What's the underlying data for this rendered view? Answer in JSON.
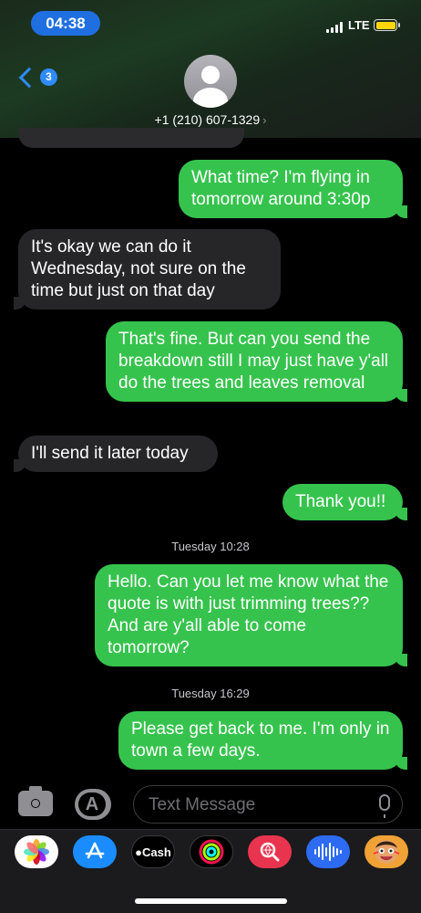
{
  "status_bar": {
    "time": "04:38",
    "network": "LTE"
  },
  "header": {
    "back_badge": "3",
    "contact": "+1 (210) 607-1329",
    "contact_chevron": "›"
  },
  "messages": [
    {
      "direction": "out",
      "text": "What time? I'm flying in tomorrow around 3:30p"
    },
    {
      "direction": "in",
      "text": "It's okay we can do it Wednesday,  not sure on the time but just on that day"
    },
    {
      "direction": "out",
      "text": "That's fine. But can you send the breakdown still I may just have y'all do the trees and leaves removal"
    },
    {
      "direction": "in",
      "text": "I'll send it later today"
    },
    {
      "direction": "out",
      "text": "Thank you!!"
    },
    {
      "direction": "out",
      "text": "Hello. Can you let me know what the quote is with just trimming trees?? And are y'all able to come tomorrow?"
    },
    {
      "direction": "out",
      "text": "Please get back to me. I'm only in town a few days."
    }
  ],
  "timestamps": [
    "Tuesday 10:28",
    "Tuesday 16:29"
  ],
  "input": {
    "placeholder": "Text Message"
  },
  "apps": [
    {
      "name": "photos-app-icon"
    },
    {
      "name": "app-store-icon"
    },
    {
      "name": "apple-cash-icon",
      "label": "Cash"
    },
    {
      "name": "activity-icon"
    },
    {
      "name": "web-search-icon"
    },
    {
      "name": "audio-message-icon"
    },
    {
      "name": "memoji-icon"
    }
  ],
  "colors": {
    "outgoing": "#36c34d",
    "incoming": "#262629",
    "accent": "#2f8bff"
  }
}
